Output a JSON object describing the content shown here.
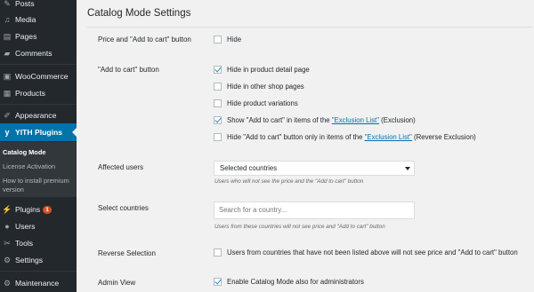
{
  "sidebar": {
    "items": [
      {
        "label": "Posts",
        "icon": "pin-icon"
      },
      {
        "label": "Media",
        "icon": "media-icon"
      },
      {
        "label": "Pages",
        "icon": "pages-icon"
      },
      {
        "label": "Comments",
        "icon": "comments-icon"
      },
      {
        "label": "WooCommerce",
        "icon": "woocommerce-icon"
      },
      {
        "label": "Products",
        "icon": "products-icon"
      },
      {
        "label": "Appearance",
        "icon": "appearance-icon"
      },
      {
        "label": "YITH Plugins",
        "icon": "yith-icon"
      },
      {
        "label": "Plugins",
        "icon": "plugins-icon",
        "badge": "1"
      },
      {
        "label": "Users",
        "icon": "users-icon"
      },
      {
        "label": "Tools",
        "icon": "tools-icon"
      },
      {
        "label": "Settings",
        "icon": "settings-icon"
      },
      {
        "label": "Maintenance",
        "icon": "maintenance-icon"
      }
    ],
    "submenu": [
      "Catalog Mode",
      "License Activation",
      "How to install premium version"
    ]
  },
  "main": {
    "title": "Catalog Mode Settings",
    "rows": {
      "price_label": "Price and \"Add to cart\" button",
      "price_hide": "Hide",
      "cart_label": "\"Add to cart\" button",
      "cart_opt1": "Hide in product detail page",
      "cart_opt2": "Hide in other shop pages",
      "cart_opt3": "Hide product variations",
      "cart_opt4_pre": "Show \"Add to cart\" in items of the ",
      "cart_opt4_link": "\"Exclusion List\"",
      "cart_opt4_post": " (Exclusion)",
      "cart_opt5_pre": "Hide \"Add to cart\" button only in items of the ",
      "cart_opt5_link": "\"Exclusion List\"",
      "cart_opt5_post": " (Reverse Exclusion)",
      "affected_label": "Affected users",
      "affected_value": "Selected countries",
      "affected_desc": "Users who will not see the price and the \"Add to cart\" button",
      "countries_label": "Select countries",
      "countries_placeholder": "Search for a country...",
      "countries_desc": "Users from these countries will not see price and \"Add to cart\" button",
      "reverse_label": "Reverse Selection",
      "reverse_text": "Users from countries that have not been listed above will not see price and \"Add to cart\" button",
      "admin_label": "Admin View",
      "admin_text": "Enable Catalog Mode also for administrators"
    },
    "checks": {
      "price_hide": false,
      "cart_opt1": true,
      "cart_opt2": false,
      "cart_opt3": false,
      "cart_opt4": true,
      "cart_opt5": false,
      "reverse": false,
      "admin": true
    }
  },
  "colors": {
    "sidebar_bg": "#23282d",
    "active_bg": "#0073aa",
    "badge": "#d54e21",
    "link": "#0073aa"
  }
}
